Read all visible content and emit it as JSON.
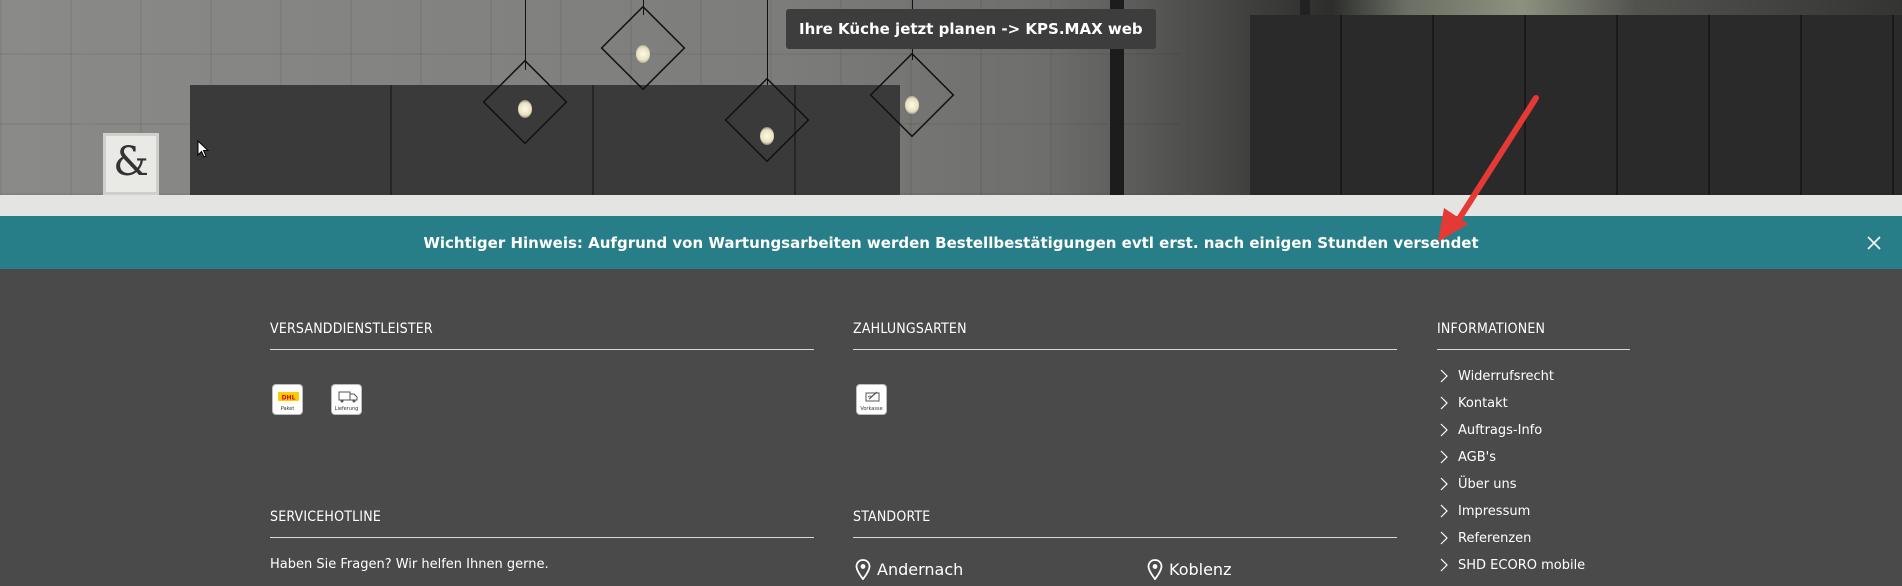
{
  "hero": {
    "plan_button_label": "Ihre Küche jetzt planen -> KPS.MAX web"
  },
  "notice": {
    "text": "Wichtiger Hinweis: Aufgrund von Wartungsarbeiten werden Bestellbestätigungen evtl erst. nach einigen Stunden versendet",
    "background": "#277e89"
  },
  "footer": {
    "shipping": {
      "title": "VERSANDDIENSTLEISTER",
      "badges": [
        {
          "label": "Paket",
          "icon": "dhl-icon"
        },
        {
          "label": "Lieferung",
          "icon": "truck-icon"
        }
      ]
    },
    "payment": {
      "title": "ZAHLUNGSARTEN",
      "badges": [
        {
          "label": "Vorkasse",
          "icon": "prepayment-icon"
        }
      ]
    },
    "information": {
      "title": "INFORMATIONEN",
      "links": [
        "Widerrufsrecht",
        "Kontakt",
        "Auftrags-Info",
        "AGB's",
        "Über uns",
        "Impressum",
        "Referenzen",
        "SHD ECORO mobile"
      ]
    },
    "hotline": {
      "title": "SERVICEHOTLINE",
      "text": "Haben Sie Fragen? Wir helfen Ihnen gerne."
    },
    "locations": {
      "title": "STANDORTE",
      "items": [
        "Andernach",
        "Koblenz"
      ]
    }
  },
  "colors": {
    "footer_bg": "#4a4a4a",
    "notice_bg": "#277e89",
    "arrow": "#e53935"
  }
}
